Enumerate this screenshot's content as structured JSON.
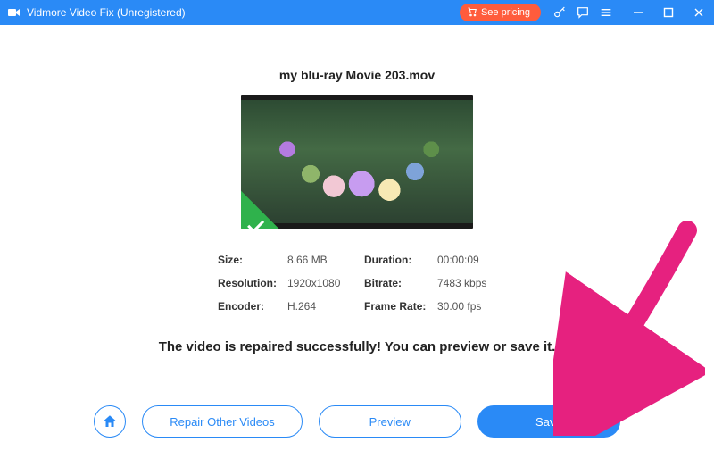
{
  "titlebar": {
    "app_name": "Vidmore Video Fix (Unregistered)",
    "pricing_label": "See pricing"
  },
  "file": {
    "name": "my blu-ray Movie 203.mov"
  },
  "meta": {
    "size_label": "Size:",
    "size_value": "8.66 MB",
    "duration_label": "Duration:",
    "duration_value": "00:00:09",
    "resolution_label": "Resolution:",
    "resolution_value": "1920x1080",
    "bitrate_label": "Bitrate:",
    "bitrate_value": "7483 kbps",
    "encoder_label": "Encoder:",
    "encoder_value": "H.264",
    "framerate_label": "Frame Rate:",
    "framerate_value": "30.00 fps"
  },
  "status": {
    "message": "The video is repaired successfully! You can preview or save it."
  },
  "actions": {
    "repair_other": "Repair Other Videos",
    "preview": "Preview",
    "save": "Save"
  }
}
